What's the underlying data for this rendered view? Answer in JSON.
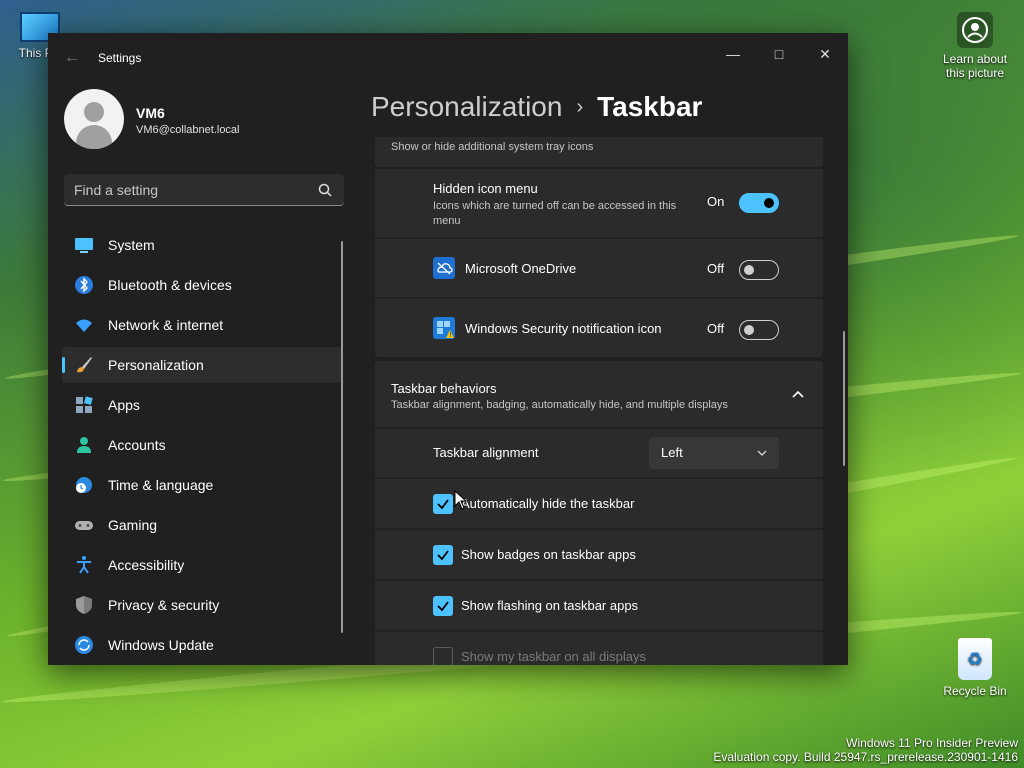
{
  "desktop": {
    "this_pc_label": "This PC",
    "learn_label_1": "Learn about",
    "learn_label_2": "this picture",
    "recycle_label": "Recycle Bin",
    "watermark_line1": "Windows 11 Pro Insider Preview",
    "watermark_line2": "Evaluation copy. Build 25947.rs_prerelease.230901-1416"
  },
  "window": {
    "title": "Settings",
    "back_glyph": "←",
    "minimize_glyph": "—",
    "maximize_glyph": "□",
    "close_glyph": "✕"
  },
  "profile": {
    "name": "VM6",
    "email": "VM6@collabnet.local"
  },
  "search": {
    "placeholder": "Find a setting"
  },
  "nav": {
    "items": [
      {
        "label": "System",
        "icon": "monitor-icon"
      },
      {
        "label": "Bluetooth & devices",
        "icon": "bluetooth-icon"
      },
      {
        "label": "Network & internet",
        "icon": "wifi-icon"
      },
      {
        "label": "Personalization",
        "icon": "brush-icon",
        "active": true
      },
      {
        "label": "Apps",
        "icon": "apps-icon"
      },
      {
        "label": "Accounts",
        "icon": "person-icon"
      },
      {
        "label": "Time & language",
        "icon": "globe-clock-icon"
      },
      {
        "label": "Gaming",
        "icon": "gamepad-icon"
      },
      {
        "label": "Accessibility",
        "icon": "accessibility-icon"
      },
      {
        "label": "Privacy & security",
        "icon": "shield-icon"
      },
      {
        "label": "Windows Update",
        "icon": "update-icon"
      }
    ]
  },
  "breadcrumb": {
    "parent": "Personalization",
    "separator": "›",
    "current": "Taskbar"
  },
  "tray": {
    "partial_desc": "Show or hide additional system tray icons",
    "hidden_menu_title": "Hidden icon menu",
    "hidden_menu_desc": "Icons which are turned off can be accessed in this menu",
    "hidden_menu_state": "On",
    "onedrive_title": "Microsoft OneDrive",
    "onedrive_state": "Off",
    "security_title": "Windows Security notification icon",
    "security_state": "Off"
  },
  "behaviors": {
    "title": "Taskbar behaviors",
    "desc": "Taskbar alignment, badging, automatically hide, and multiple displays",
    "chevron": "⌃",
    "alignment_label": "Taskbar alignment",
    "alignment_value": "Left",
    "auto_hide": "Automatically hide the taskbar",
    "badges": "Show badges on taskbar apps",
    "flashing": "Show flashing on taskbar apps",
    "all_displays": "Show my taskbar on all displays"
  },
  "colors": {
    "accent": "#4cc2ff",
    "window_bg": "#202020",
    "card_bg": "#2b2b2b"
  }
}
